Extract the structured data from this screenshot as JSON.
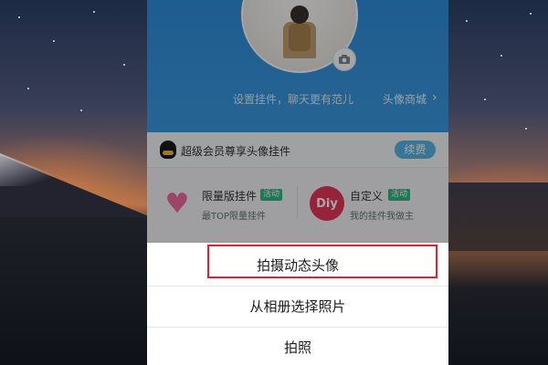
{
  "profile": {
    "hint_text": "设置挂件，聊天更有范儿",
    "store_link": "头像商城",
    "icons": [
      "camera-icon",
      "chevron-right-icon"
    ]
  },
  "vip_bar": {
    "text": "超级会员尊享头像挂件",
    "renew_button": "续费",
    "icon": "qq-penguin-icon"
  },
  "features": [
    {
      "title": "限量版挂件",
      "badge": "活动",
      "subtitle": "最TOP限量挂件",
      "icon": "heart-icon"
    },
    {
      "title": "自定义",
      "badge": "活动",
      "subtitle": "我的挂件我做主",
      "icon": "diy-icon",
      "icon_text": "Diy"
    }
  ],
  "action_sheet": {
    "items": [
      "拍摄动态头像",
      "从相册选择照片",
      "拍照"
    ],
    "highlighted_index": 0,
    "highlight_color": "#d8243b"
  },
  "colors": {
    "header_blue": "#2f8fdc",
    "renew_button": "#56b5e8",
    "badge_green": "#2dbb84"
  }
}
